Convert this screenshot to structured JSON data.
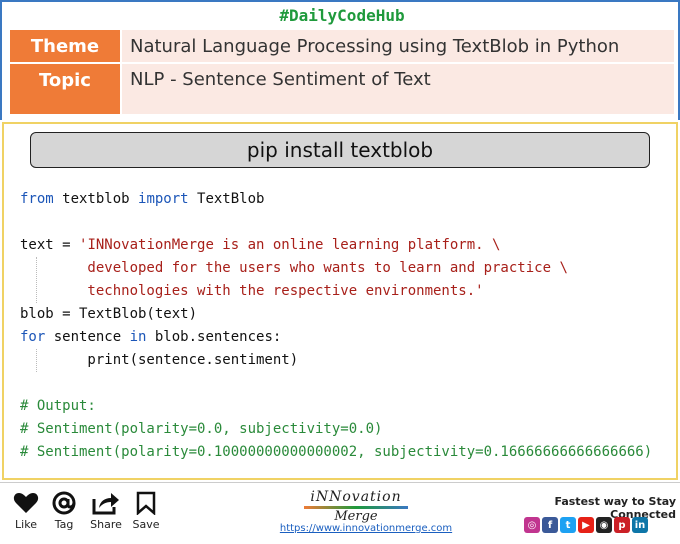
{
  "header": {
    "hashtag": "#DailyCodeHub",
    "rows": [
      {
        "label": "Theme",
        "value": "Natural Language Processing using TextBlob in Python"
      },
      {
        "label": "Topic",
        "value": "NLP - Sentence Sentiment of Text"
      }
    ]
  },
  "install_command": "pip install textblob",
  "code_lines": [
    {
      "kw1": "from",
      "t1": " textblob ",
      "kw2": "import",
      "t2": " TextBlob"
    },
    {},
    {
      "a": "text = ",
      "s": "'INNovationMerge is an online learning platform. \\"
    },
    {
      "s": "        developed for the users who wants to learn and practice \\"
    },
    {
      "s": "        technologies with the respective environments.'"
    },
    {
      "a": "blob = TextBlob(text)"
    },
    {
      "kw1": "for",
      "t1": " sentence ",
      "kw2": "in",
      "t2": " blob.sentences:"
    },
    {
      "a": "        print(sentence.sentiment)"
    },
    {},
    {
      "c": "# Output:"
    },
    {
      "c": "# Sentiment(polarity=0.0, subjectivity=0.0)"
    },
    {
      "c": "# Sentiment(polarity=0.10000000000000002, subjectivity=0.16666666666666666)"
    }
  ],
  "footer": {
    "actions": {
      "like": "Like",
      "tag": "Tag",
      "share": "Share",
      "save": "Save"
    },
    "logo_line1": "iNNovation",
    "logo_line2": "Merge",
    "url": "https://www.innovationmerge.com",
    "tagline": "Fastest way to Stay Connected",
    "social_icons": [
      {
        "icon": "instagram-icon",
        "glyph": "◎",
        "color": "#c1358f"
      },
      {
        "icon": "facebook-icon",
        "glyph": "f",
        "color": "#3b5998"
      },
      {
        "icon": "twitter-icon",
        "glyph": "t",
        "color": "#1da1f2"
      },
      {
        "icon": "youtube-icon",
        "glyph": "▶",
        "color": "#e62117"
      },
      {
        "icon": "github-icon",
        "glyph": "◉",
        "color": "#222222"
      },
      {
        "icon": "pinterest-icon",
        "glyph": "p",
        "color": "#cb2027"
      },
      {
        "icon": "linkedin-icon",
        "glyph": "in",
        "color": "#0e76a8"
      }
    ]
  },
  "colors": {
    "accent_orange": "#ef7b37",
    "hashtag_green": "#1f9a3c",
    "keyword_blue": "#1c56b8",
    "string_red": "#a8201a",
    "comment_green": "#2a8a3a"
  }
}
